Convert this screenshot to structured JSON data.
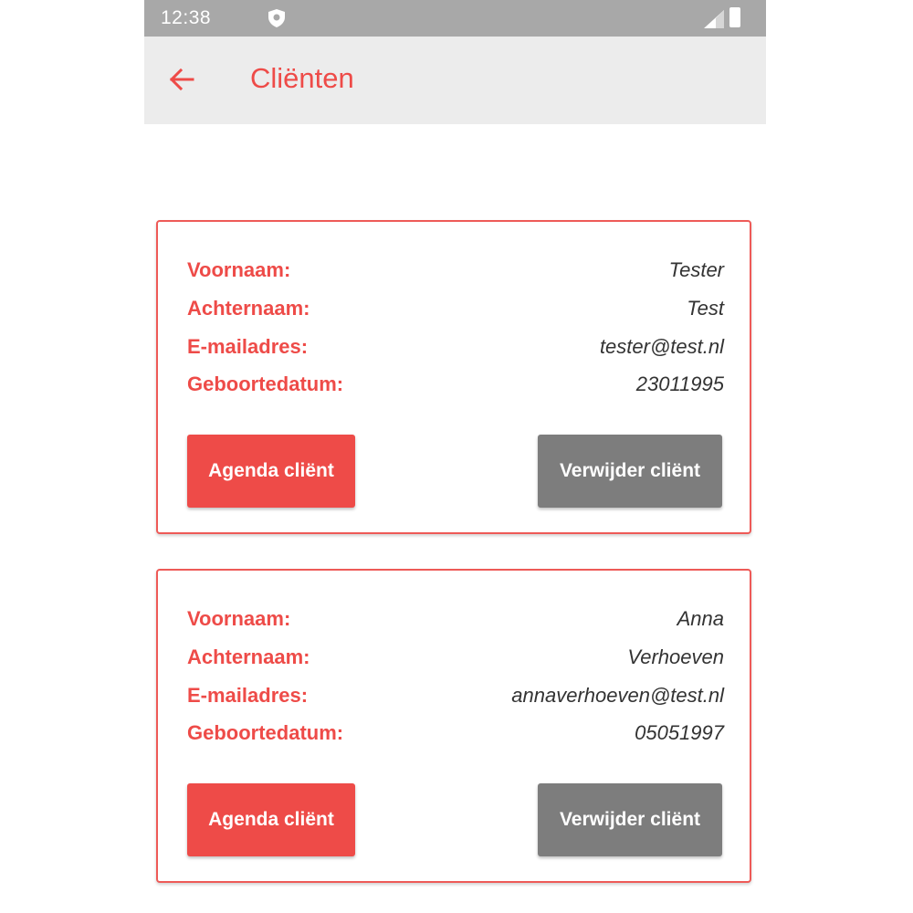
{
  "status_bar": {
    "time": "12:38",
    "icons": [
      "shield-icon",
      "signal-icon",
      "battery-icon"
    ]
  },
  "app_bar": {
    "back_icon": "arrow-left-icon",
    "title": "Cliënten"
  },
  "colors": {
    "accent": "#ee4b48",
    "delete_button": "#7d7d7d",
    "status_bar": "#a8a8a8",
    "app_bar": "#ececec"
  },
  "labels": {
    "first_name": "Voornaam:",
    "last_name": "Achternaam:",
    "email": "E-mailadres:",
    "birth_date": "Geboortedatum:",
    "agenda_button": "Agenda cliënt",
    "delete_button": "Verwijder cliënt"
  },
  "clients": [
    {
      "first_name": "Tester",
      "last_name": "Test",
      "email": "tester@test.nl",
      "birth_date": "23011995"
    },
    {
      "first_name": "Anna",
      "last_name": "Verhoeven",
      "email": "annaverhoeven@test.nl",
      "birth_date": "05051997"
    }
  ]
}
